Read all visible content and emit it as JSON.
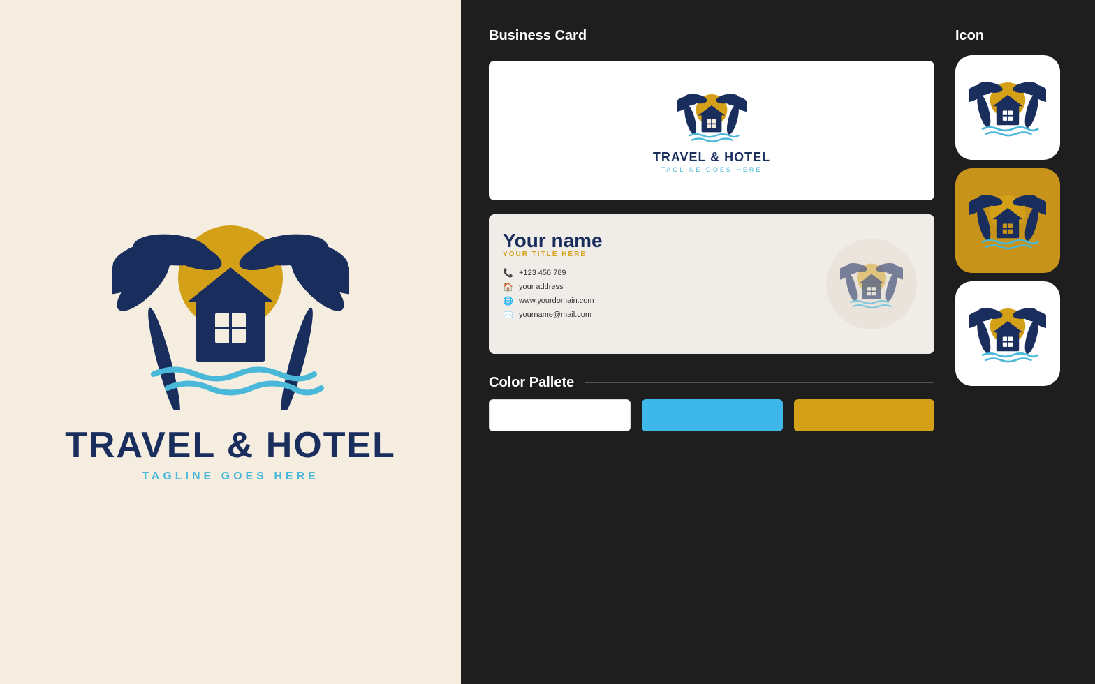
{
  "left": {
    "brand_name": "TRAVEL & HOTEL",
    "tagline": "TAGLINE GOES HERE"
  },
  "right": {
    "business_card_label": "Business Card",
    "icon_label": "Icon",
    "color_palette_label": "Color Pallete",
    "card_front": {
      "brand_name": "TRAVEL & HOTEL",
      "tagline": "TAGLINE GOES HERE"
    },
    "card_back": {
      "name": "Your name",
      "title": "YOUR TITLE HERE",
      "phone": "+123 456 789",
      "address": "your address",
      "website": "www.yourdomain.com",
      "email": "yourname@mail.com"
    },
    "colors": {
      "white": "#ffffff",
      "blue": "#3db8e8",
      "gold": "#d4a017"
    }
  }
}
